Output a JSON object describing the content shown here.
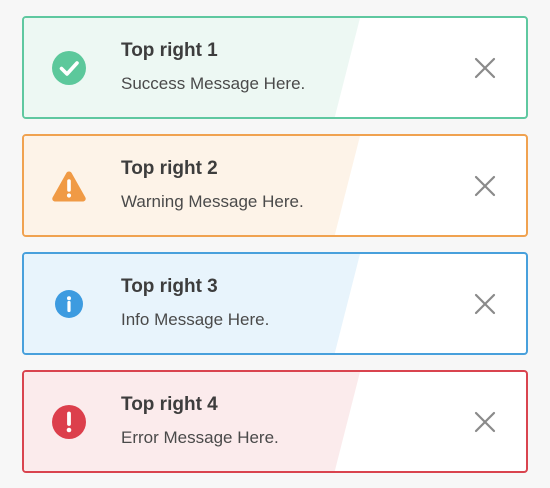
{
  "toasts": [
    {
      "title": "Top right 1",
      "message": "Success Message Here.",
      "type": "success",
      "icon": "check-circle-icon",
      "border_color": "#5fc8a0",
      "tint_color": "#edf8f3",
      "icon_color": "#5cc89b"
    },
    {
      "title": "Top right 2",
      "message": "Warning Message Here.",
      "type": "warning",
      "icon": "warning-triangle-icon",
      "border_color": "#f0a250",
      "tint_color": "#fdf3e8",
      "icon_color": "#f09a45"
    },
    {
      "title": "Top right 3",
      "message": "Info Message Here.",
      "type": "info",
      "icon": "info-circle-icon",
      "border_color": "#48a0dc",
      "tint_color": "#e8f4fc",
      "icon_color": "#3d9be0"
    },
    {
      "title": "Top right 4",
      "message": "Error Message Here.",
      "type": "error",
      "icon": "error-circle-icon",
      "border_color": "#d9444f",
      "tint_color": "#fbebec",
      "icon_color": "#dc3f4c"
    }
  ],
  "close_icon": "close-icon",
  "close_color": "#8a8a8a"
}
